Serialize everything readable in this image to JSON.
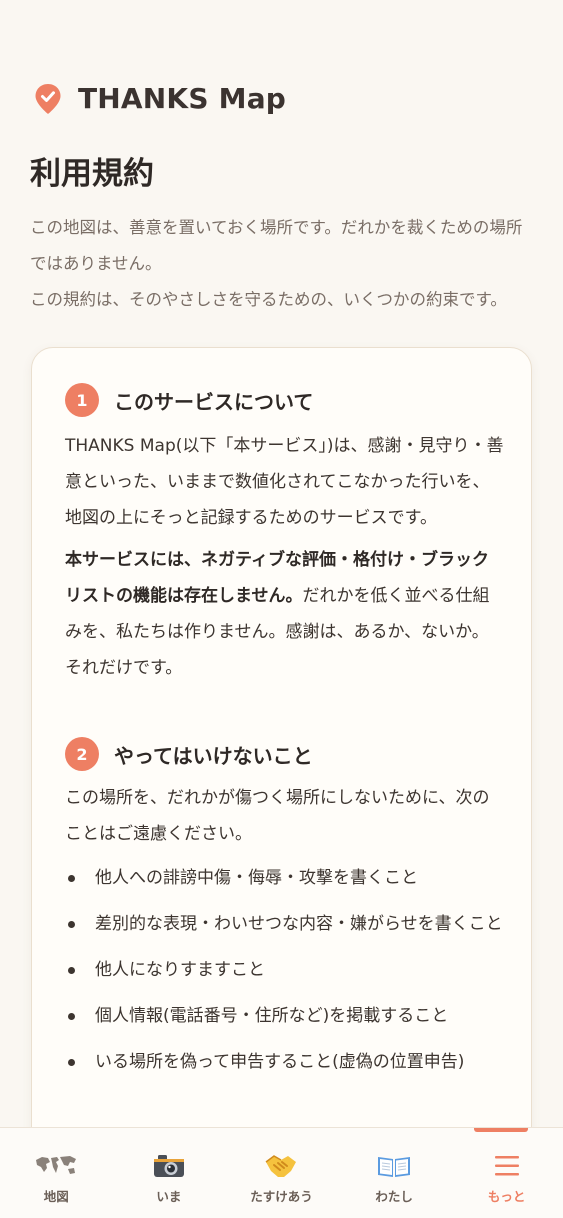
{
  "app": {
    "name": "THANKS Map",
    "accent_color": "#ee7f63",
    "brand_icon": "map-pin-check-icon"
  },
  "page": {
    "title": "利用規約",
    "intro": [
      "この地図は、善意を置いておく場所です。だれかを裁くための場所ではありません。",
      "この規約は、そのやさしさを守るための、いくつかの約束です。"
    ]
  },
  "sections": [
    {
      "number": "1",
      "title": "このサービスについて",
      "para1": "THANKS Map(以下「本サービス」)は、感謝・見守り・善意といった、いままで数値化されてこなかった行いを、地図の上にそっと記録するためのサービスです。",
      "para2_bold": "本サービスには、ネガティブな評価・格付け・ブラックリストの機能は存在しません。",
      "para2_rest": "だれかを低く並べる仕組みを、私たちは作りません。感謝は、あるか、ないか。それだけです。"
    },
    {
      "number": "2",
      "title": "やってはいけないこと",
      "intro": "この場所を、だれかが傷つく場所にしないために、次のことはご遠慮ください。",
      "items": [
        "他人への誹謗中傷・侮辱・攻撃を書くこと",
        "差別的な表現・わいせつな内容・嫌がらせを書くこと",
        "他人になりすますこと",
        "個人情報(電話番号・住所など)を掲載すること",
        "いる場所を偽って申告すること(虚偽の位置申告)"
      ]
    }
  ],
  "nav": {
    "active": "もっと",
    "items": [
      {
        "label": "地図",
        "icon": "world-map-icon"
      },
      {
        "label": "いま",
        "icon": "camera-icon"
      },
      {
        "label": "たすけあう",
        "icon": "handshake-icon"
      },
      {
        "label": "わたし",
        "icon": "open-book-icon"
      },
      {
        "label": "もっと",
        "icon": "hamburger-menu-icon"
      }
    ]
  }
}
